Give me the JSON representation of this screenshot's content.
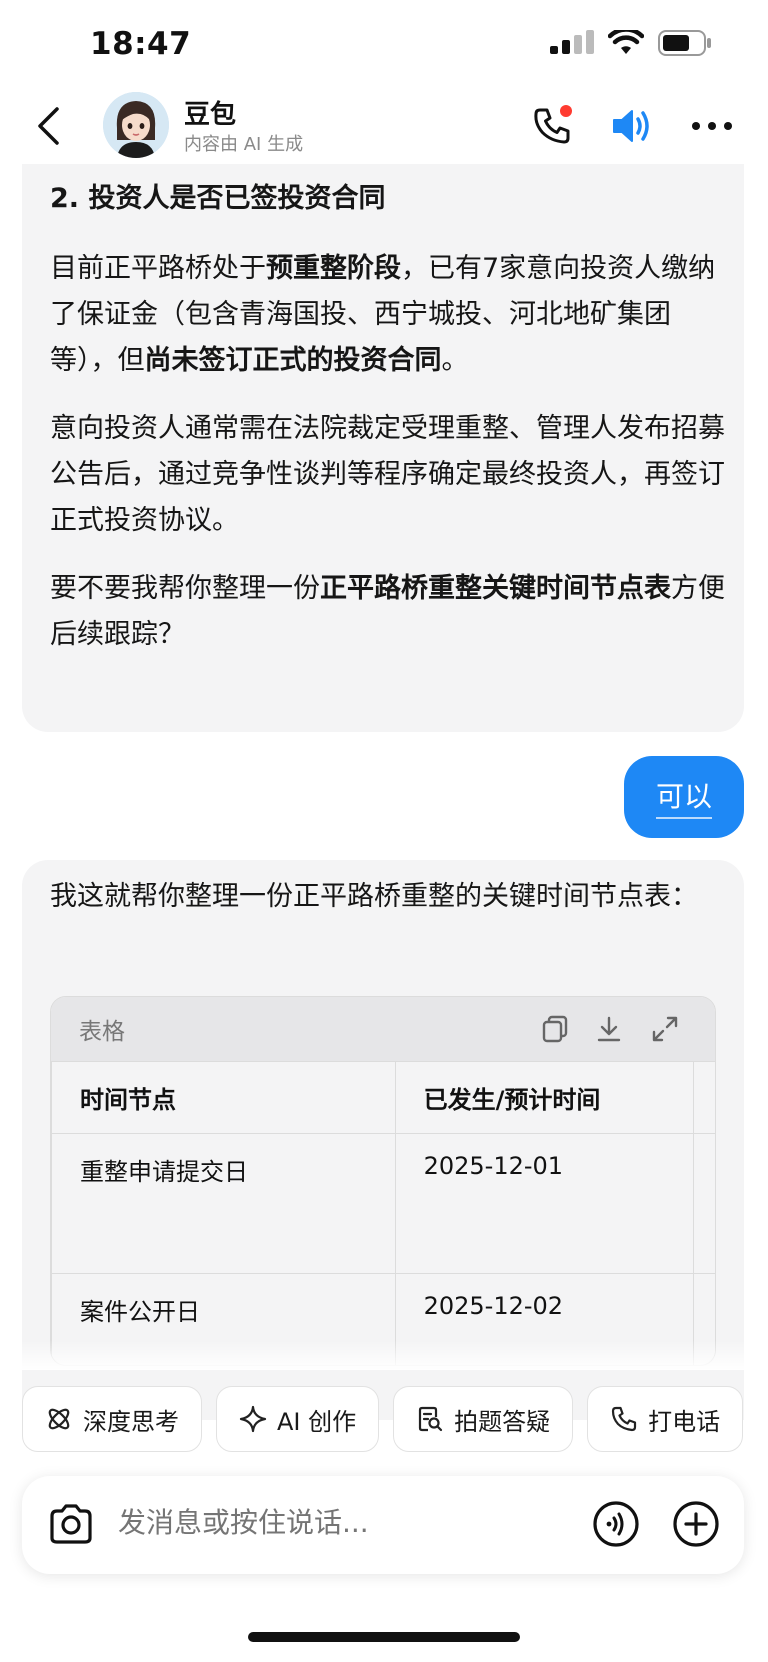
{
  "status": {
    "time": "18:47"
  },
  "header": {
    "name": "豆包",
    "subtitle": "内容由 AI 生成"
  },
  "message1": {
    "heading": "2. 投资人是否已签投资合同",
    "p1_a": "目前正平路桥处于",
    "p1_b": "预重整阶段",
    "p1_c": "，已有7家意向投资人缴纳了保证金（包含青海国投、西宁城投、河北地矿集团等），但",
    "p1_d": "尚未签订正式的投资合同",
    "p1_e": "。",
    "p2": "意向投资人通常需在法院裁定受理重整、管理人发布招募公告后，通过竞争性谈判等程序确定最终投资人，再签订正式投资协议。",
    "p3_a": "要不要我帮你整理一份",
    "p3_b": "正平路桥重整关键时间节点表",
    "p3_c": "方便后续跟踪？"
  },
  "user_message": {
    "text": "可以"
  },
  "message2": {
    "intro": "我这就帮你整理一份正平路桥重整的关键时间节点表：",
    "table": {
      "label": "表格",
      "headers": [
        "时间节点",
        "已发生/预计时间"
      ],
      "rows": [
        [
          "重整申请提交日",
          "2025-12-01"
        ],
        [
          "案件公开日",
          "2025-12-02"
        ]
      ]
    }
  },
  "quick_actions": [
    {
      "label": "深度思考",
      "icon": "atom-icon"
    },
    {
      "label": "AI 创作",
      "icon": "sparkle-icon"
    },
    {
      "label": "拍题答疑",
      "icon": "search-doc-icon"
    },
    {
      "label": "打电话",
      "icon": "phone-icon"
    }
  ],
  "input": {
    "placeholder": "发消息或按住说话..."
  },
  "colors": {
    "accent": "#1e88f5",
    "bubble_bg": "#f4f4f5",
    "notification_dot": "#ff3b30"
  }
}
